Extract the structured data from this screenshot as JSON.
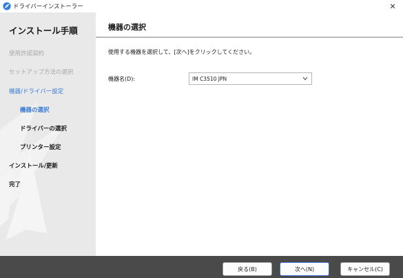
{
  "window": {
    "title": "ドライバーインストーラー",
    "close_glyph": "✕"
  },
  "sidebar": {
    "heading": "インストール手順",
    "steps": [
      {
        "label": "使用許諾契約",
        "state": "done"
      },
      {
        "label": "セットアップ方法の選択",
        "state": "done"
      },
      {
        "label": "機器/ドライバー設定",
        "state": "active"
      },
      {
        "label": "機器の選択",
        "state": "current-sub"
      },
      {
        "label": "ドライバーの選択",
        "state": "pending-sub"
      },
      {
        "label": "プリンター設定",
        "state": "pending-sub"
      },
      {
        "label": "インストール/更新",
        "state": "pending"
      },
      {
        "label": "完了",
        "state": "pending"
      }
    ]
  },
  "main": {
    "title": "機器の選択",
    "instruction": "使用する機器を選択して、[次へ]をクリックしてください。",
    "device_field": {
      "label": "機器名(D):",
      "value": "IM C3510 JPN"
    }
  },
  "footer": {
    "back_label": "戻る(B)",
    "next_label": "次へ(N)",
    "cancel_label": "キャンセル(C)"
  },
  "colors": {
    "accent": "#3a7bd5",
    "sidebar_bg": "#e9e9e9",
    "footer_bg": "#4a4a4a",
    "done_text": "#a8a8a8"
  },
  "icons": {
    "app": "installer-feather-icon",
    "close": "close-icon",
    "dropdown": "chevron-down-icon"
  }
}
